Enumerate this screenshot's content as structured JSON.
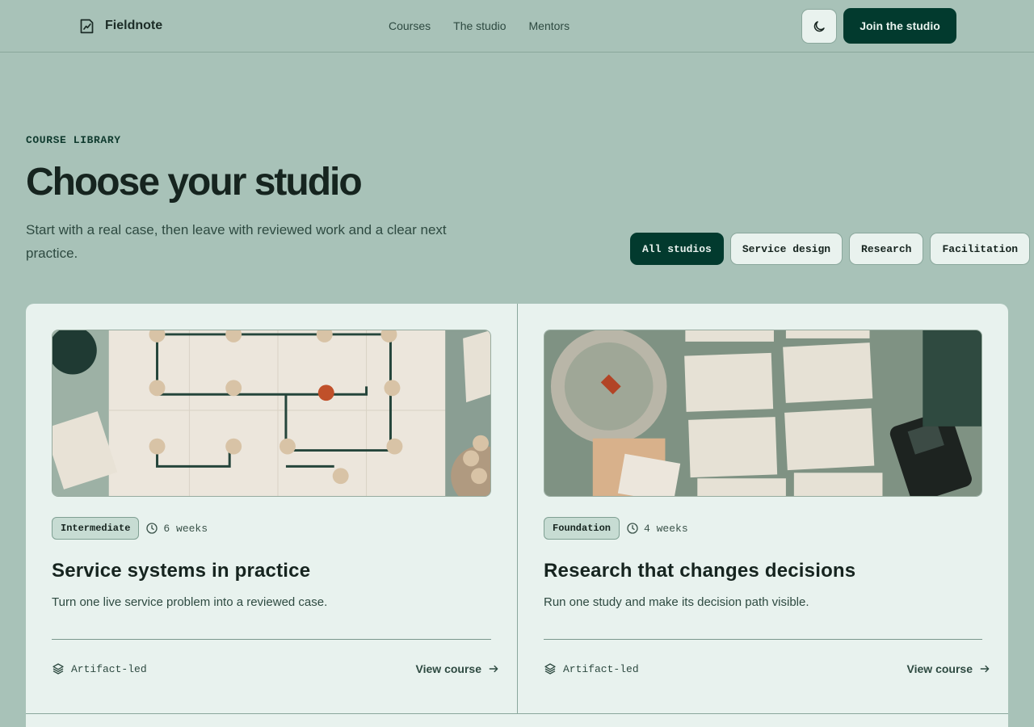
{
  "header": {
    "brand": "Fieldnote",
    "nav": [
      "Courses",
      "The studio",
      "Mentors"
    ],
    "theme_icon": "moon-icon",
    "cta": "Join the studio"
  },
  "hero": {
    "eyebrow": "COURSE LIBRARY",
    "title": "Choose your studio",
    "lede": "Start with a real case, then leave with reviewed work and a clear next practice."
  },
  "filters": {
    "options": [
      "All studios",
      "Service design",
      "Research",
      "Facilitation"
    ],
    "selected": "All studios"
  },
  "courses": [
    {
      "level": "Intermediate",
      "duration": "6 weeks",
      "title": "Service systems in practice",
      "description": "Turn one live service problem into a reviewed case.",
      "format": "Artifact-led",
      "link": "View course"
    },
    {
      "level": "Foundation",
      "duration": "4 weeks",
      "title": "Research that changes decisions",
      "description": "Run one study and make its decision path visible.",
      "format": "Artifact-led",
      "link": "View course"
    }
  ],
  "colors": {
    "page_bg": "#a8c2b8",
    "card_bg": "#e8f2ee",
    "accent": "#023a2e"
  }
}
